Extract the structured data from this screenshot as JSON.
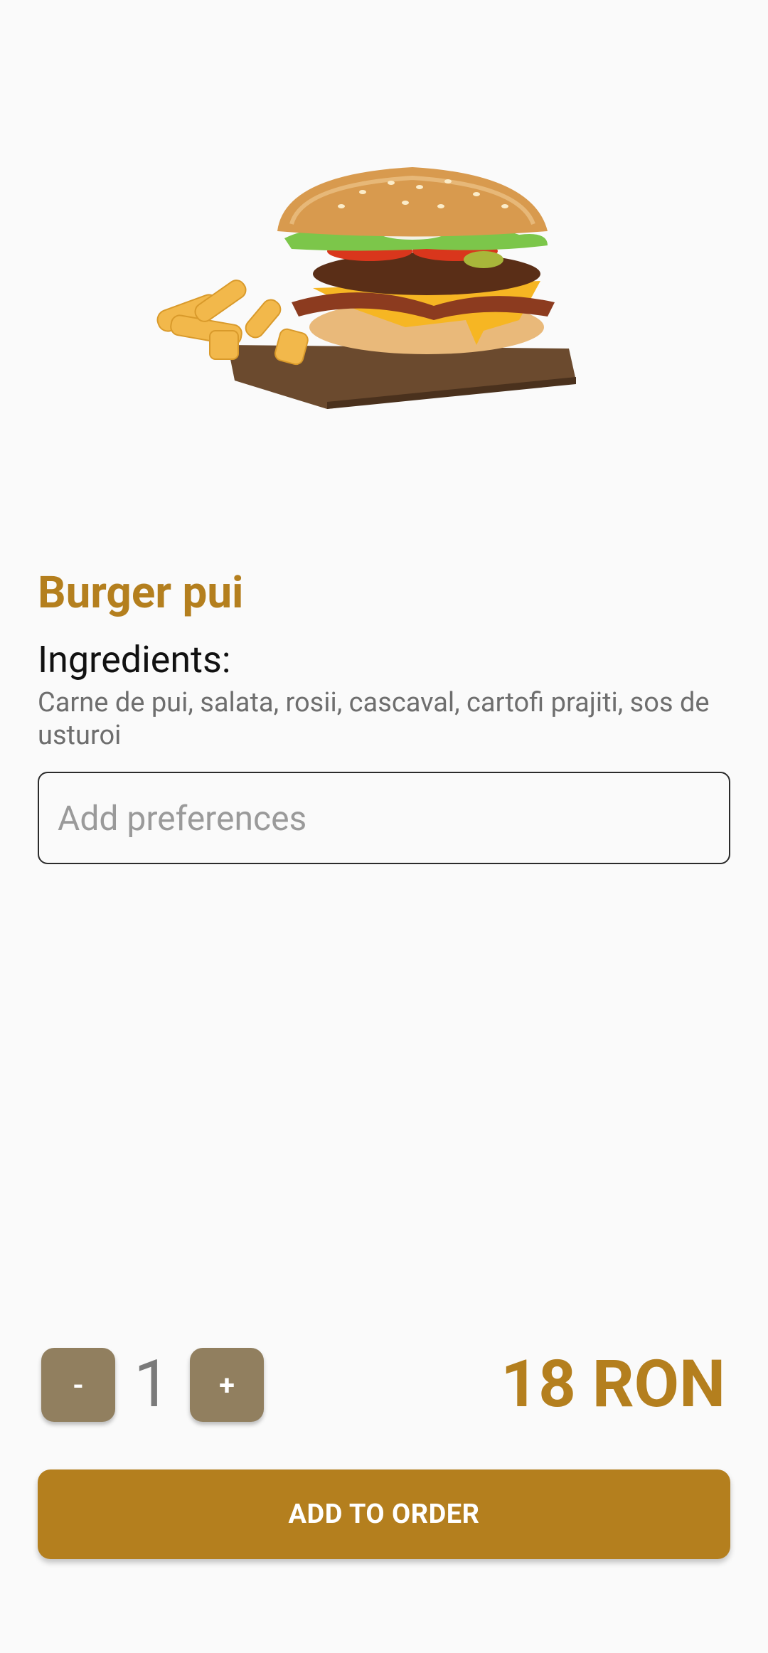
{
  "product": {
    "name": "Burger pui",
    "ingredients_heading": "Ingredients:",
    "ingredients": "Carne de pui, salata, rosii, cascaval, cartofi prajiti, sos de usturoi",
    "image_icon": "burger-with-fries-image"
  },
  "preferences": {
    "placeholder": "Add preferences",
    "value": ""
  },
  "quantity": {
    "minus_label": "-",
    "plus_label": "+",
    "value": "1"
  },
  "price": {
    "text": "18 RON"
  },
  "actions": {
    "add_to_order_label": "ADD TO ORDER"
  },
  "colors": {
    "accent": "#b47f1e",
    "stepper": "#917f5f",
    "background": "#fafafa"
  }
}
